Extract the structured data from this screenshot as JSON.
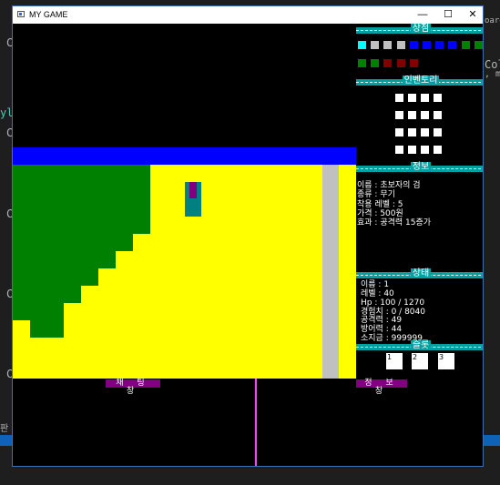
{
  "background_ide": {
    "left_glyphs": [
      "C",
      "C",
      "C",
      "C",
      "C",
      "C"
    ],
    "left_snip": "yla",
    "right_snip_1": "Col",
    "right_snip_2": ", m",
    "top_right_tab": "oard",
    "bottom_left": "판"
  },
  "window": {
    "title": "MY GAME",
    "min_label": "—",
    "max_label": "☐",
    "close_label": "✕"
  },
  "game": {
    "map": {
      "grass_color": "#008000",
      "sand_color": "#ffff00",
      "water_color": "#0000ff",
      "road_color": "#c0c0c0"
    },
    "shop": {
      "title": "상점",
      "row1": [
        "#00ffff",
        "#c0c0c0",
        "#c0c0c0",
        "#c0c0c0",
        "#0000ff",
        "#0000ff",
        "#0000ff",
        "#0000ff",
        "#008000",
        "#008000"
      ],
      "row2": [
        "#008000",
        "#008000",
        "#800000",
        "#800000",
        "#800000"
      ]
    },
    "inventory": {
      "title": "인벤토리"
    },
    "item_info": {
      "title": "정보",
      "name": "이름 : 초보자의 검",
      "type": "종류 : 무기",
      "level": "착용 레벨 : 5",
      "price": "가격 : 500원",
      "effect": "효과 : 공격력 15증가"
    },
    "status": {
      "title": "상태",
      "name": "이름 : 1",
      "level": "레벨 : 40",
      "hp": "Hp : 100 / 1270",
      "exp": "경험치 : 0 / 8040",
      "atk": "공격력 : 49",
      "def": "방어력 : 44",
      "gold": "소지금 : 999999"
    },
    "quickslot": {
      "title": "슬롯",
      "slots": [
        "1",
        "2",
        "3"
      ]
    },
    "chat_label": "채 팅 창",
    "info_label": "정 보 창"
  }
}
